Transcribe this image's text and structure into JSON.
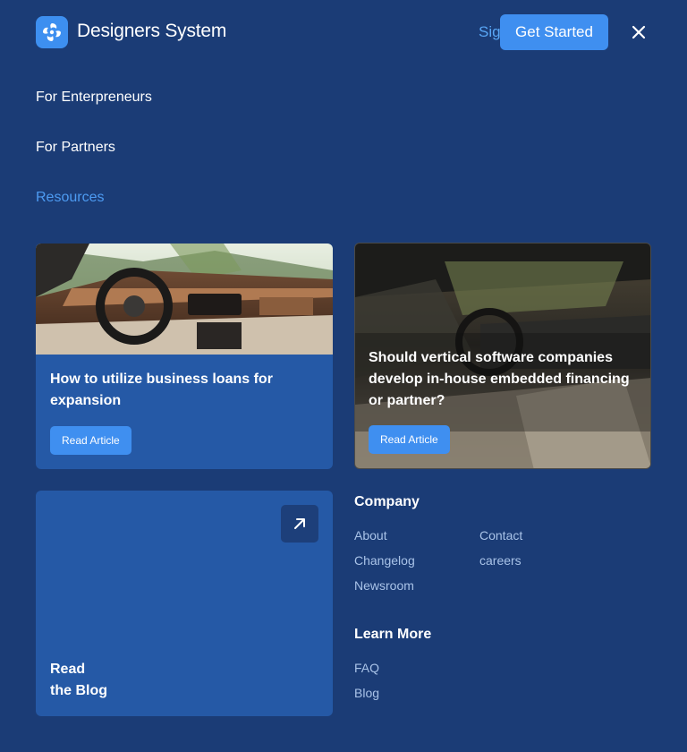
{
  "header": {
    "brand": "Designers System",
    "signin_label": "Sign in",
    "cta_label": "Get Started"
  },
  "nav": {
    "items": [
      {
        "label": "For Enterpreneurs"
      },
      {
        "label": "For Partners"
      },
      {
        "label": "Resources"
      }
    ]
  },
  "cards": [
    {
      "title": "How to utilize business loans for expansion",
      "button": "Read Article"
    },
    {
      "title": "Should vertical software companies develop in-house embedded financing or partner?",
      "button": "Read Article"
    }
  ],
  "blog": {
    "line1": "Read",
    "line2": "the Blog"
  },
  "footer": {
    "company": {
      "title": "Company",
      "links": [
        "About",
        "Contact",
        "Changelog",
        "careers",
        "Newsroom"
      ]
    },
    "learn": {
      "title": "Learn More",
      "links": [
        "FAQ",
        "Blog"
      ]
    }
  },
  "colors": {
    "background": "#1b3c76",
    "card": "#2559a6",
    "accent": "#3f8ff0",
    "active_link": "#4d9bf2"
  },
  "icons": {
    "logo": "swirl-logo-icon",
    "close": "close-icon",
    "arrow": "arrow-up-right-icon"
  }
}
